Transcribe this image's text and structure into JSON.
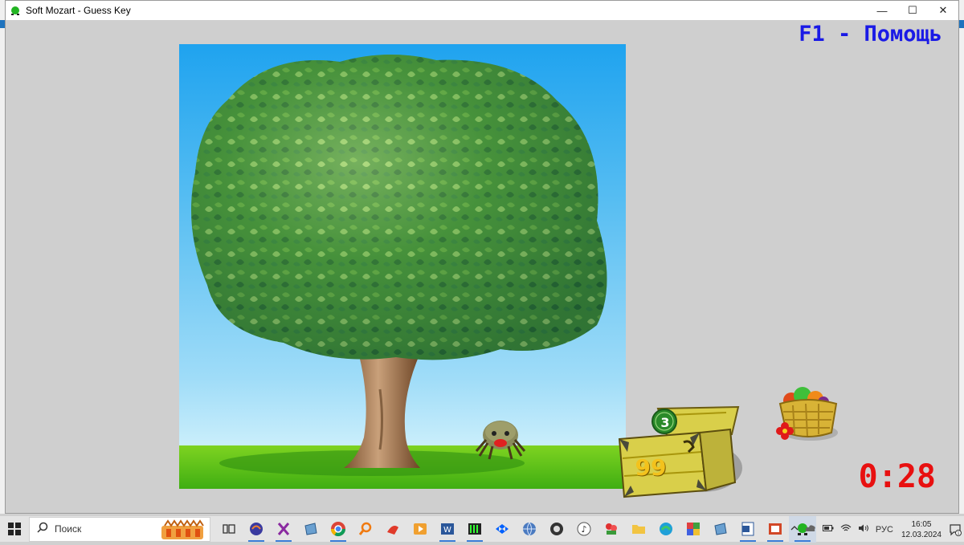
{
  "window": {
    "title": "Soft Mozart - Guess Key",
    "minimize_glyph": "—",
    "maximize_glyph": "☐",
    "close_glyph": "✕"
  },
  "help_hint": "F1 - Помощь",
  "game": {
    "chest_count": "99",
    "coin_count": "3",
    "timer": "0:28"
  },
  "taskbar": {
    "search_placeholder": "Поиск",
    "language": "РУС",
    "time": "16:05",
    "date": "12.03.2024",
    "notification_count": "1",
    "icons": [
      "task-view-icon",
      "headset-app-icon",
      "x-app-icon",
      "notes-app-icon",
      "chrome-icon",
      "search-tool-icon",
      "red-tool-icon",
      "media-player-icon",
      "word-icon",
      "piano-app-icon",
      "dropbox-icon",
      "globe-app-icon",
      "camera-app-icon",
      "music-app-icon",
      "flowers-app-icon",
      "file-explorer-icon",
      "edge-icon",
      "color-app-icon",
      "notes-app-icon-2",
      "word-doc-icon",
      "presentation-icon",
      "soft-mozart-icon"
    ]
  },
  "colors": {
    "help_hint": "#1a1ae6",
    "timer": "#e81010",
    "chest_number": "#f3c21c"
  }
}
